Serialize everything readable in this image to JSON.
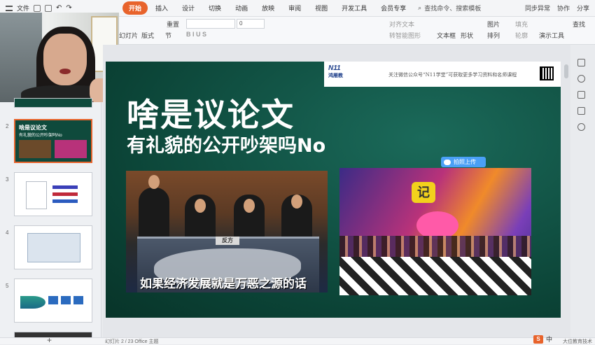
{
  "menubar": {
    "file_label": "文件",
    "tabs": [
      "开始",
      "插入",
      "设计",
      "切换",
      "动画",
      "放映",
      "审阅",
      "视图",
      "开发工具",
      "会员专享"
    ],
    "search_placeholder": "查找命令、搜索模板",
    "sync_label": "同步异常",
    "collab_label": "协作",
    "share_label": "分享"
  },
  "ribbon": {
    "new_slide": "幻灯片",
    "layout": "版式",
    "section": "节",
    "reset": "重置",
    "font_size": "0",
    "text_box": "文本框",
    "shape": "形状",
    "picture": "图片",
    "fill": "填充",
    "arrange": "排列",
    "outline": "轮廓",
    "presenter_tools": "演示工具",
    "align_text": "对齐文本",
    "convert_smartart": "转智能图形",
    "find": "查找"
  },
  "thumbnails": [
    {
      "num": "2",
      "title": "啥是议论文",
      "sub": "有礼貌的公开吵架吗No"
    },
    {
      "num": "3"
    },
    {
      "num": "4"
    },
    {
      "num": "5"
    }
  ],
  "slide": {
    "banner_logo_mark": "N11",
    "banner_logo_name": "鸿雁教",
    "banner_note": "关注微信公众号“N11学堂”可获取更多学习资料和名师课程",
    "title": "啥是议论文",
    "subtitle": "有礼貌的公开吵架吗No",
    "debate_plate": "反方",
    "caption": "如果经济发展就是万恶之源的话"
  },
  "upload_label": "拍照上传",
  "ime": {
    "badge": "S",
    "lang": "中"
  },
  "status": {
    "slide_info": "幻灯片 2 / 23  Office 主题",
    "right": "大位教育技术"
  },
  "colors": {
    "accent": "#e8632b",
    "slide_bg": "#0b4336",
    "upload": "#4a9ff5"
  }
}
